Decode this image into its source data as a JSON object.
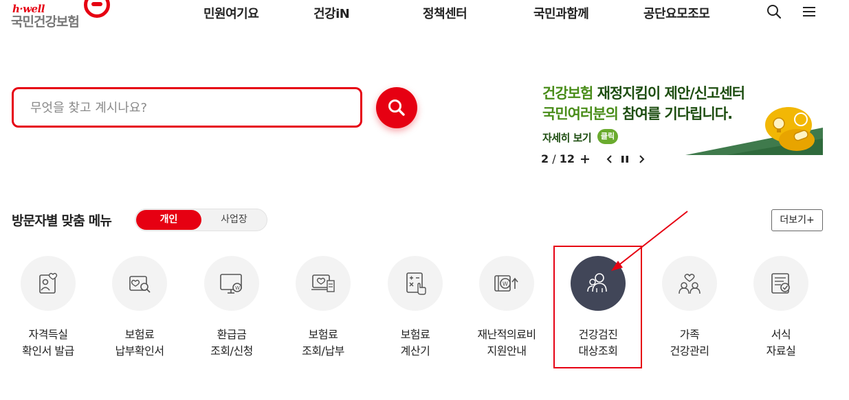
{
  "logo": {
    "tagline": "h·well",
    "name": "국민건강보험"
  },
  "nav": {
    "items": [
      {
        "label": "민원여기요"
      },
      {
        "label": "건강iN"
      },
      {
        "label": "정책센터"
      },
      {
        "label": "국민과함께"
      },
      {
        "label": "공단요모조모"
      }
    ],
    "search_icon": "search-icon",
    "menu_icon": "hamburger-menu-icon"
  },
  "search": {
    "placeholder": "무엇을 찾고 계시나요?",
    "value": "",
    "button_icon": "search-icon"
  },
  "banner": {
    "line1_green": "건강보험 ",
    "line1_dark": "재정지킴이 제안/신고센터",
    "line2_green": "국민여러분",
    "line2_mid": "의 ",
    "line2_dark": "참여를 기다립니다.",
    "more_label": "자세히 보기",
    "click_badge": "클릭",
    "colors": {
      "green": "#4a8d1a",
      "dark_green": "#1d4d10",
      "gold": "#f2b705"
    }
  },
  "pager": {
    "current": "2",
    "separator": " / ",
    "total": "12",
    "add_icon": "plus-icon",
    "prev_icon": "chevron-left-icon",
    "pause_icon": "pause-icon",
    "next_icon": "chevron-right-icon"
  },
  "visitor_menu": {
    "title": "방문자별 맞춤 메뉴",
    "toggle": {
      "personal": "개인",
      "business": "사업장",
      "selected": "개인"
    },
    "more_button": "더보기+",
    "items": [
      {
        "line1": "자격득실",
        "line2": "확인서 발급",
        "icon": "person-certificate-icon"
      },
      {
        "line1": "보험료",
        "line2": "납부확인서",
        "icon": "document-search-icon"
      },
      {
        "line1": "환급금",
        "line2": "조회/신청",
        "icon": "monitor-refund-icon"
      },
      {
        "line1": "보험료",
        "line2": "조회/납부",
        "icon": "laptop-receipt-icon"
      },
      {
        "line1": "보험료",
        "line2": "계산기",
        "icon": "calculator-icon"
      },
      {
        "line1": "재난적의료비",
        "line2": "지원안내",
        "icon": "money-support-icon"
      },
      {
        "line1": "건강검진",
        "line2": "대상조회",
        "icon": "people-group-icon",
        "highlighted": true
      },
      {
        "line1": "가족",
        "line2": "건강관리",
        "icon": "family-heart-icon"
      },
      {
        "line1": "서식",
        "line2": "자료실",
        "icon": "form-document-icon"
      }
    ]
  },
  "colors": {
    "brand_red": "#e60012",
    "active_icon_bg": "#414658",
    "icon_bg": "#f3f3f3"
  }
}
